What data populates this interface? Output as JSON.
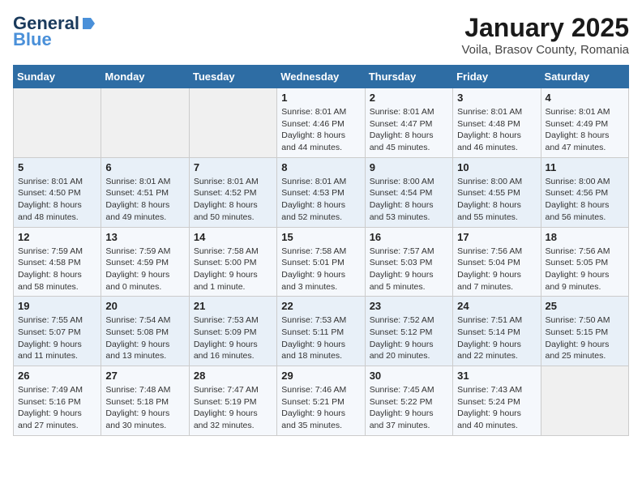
{
  "logo": {
    "brand1": "General",
    "brand2": "Blue",
    "tagline": ""
  },
  "header": {
    "title": "January 2025",
    "subtitle": "Voila, Brasov County, Romania"
  },
  "weekdays": [
    "Sunday",
    "Monday",
    "Tuesday",
    "Wednesday",
    "Thursday",
    "Friday",
    "Saturday"
  ],
  "weeks": [
    [
      {
        "day": "",
        "info": ""
      },
      {
        "day": "",
        "info": ""
      },
      {
        "day": "",
        "info": ""
      },
      {
        "day": "1",
        "info": "Sunrise: 8:01 AM\nSunset: 4:46 PM\nDaylight: 8 hours\nand 44 minutes."
      },
      {
        "day": "2",
        "info": "Sunrise: 8:01 AM\nSunset: 4:47 PM\nDaylight: 8 hours\nand 45 minutes."
      },
      {
        "day": "3",
        "info": "Sunrise: 8:01 AM\nSunset: 4:48 PM\nDaylight: 8 hours\nand 46 minutes."
      },
      {
        "day": "4",
        "info": "Sunrise: 8:01 AM\nSunset: 4:49 PM\nDaylight: 8 hours\nand 47 minutes."
      }
    ],
    [
      {
        "day": "5",
        "info": "Sunrise: 8:01 AM\nSunset: 4:50 PM\nDaylight: 8 hours\nand 48 minutes."
      },
      {
        "day": "6",
        "info": "Sunrise: 8:01 AM\nSunset: 4:51 PM\nDaylight: 8 hours\nand 49 minutes."
      },
      {
        "day": "7",
        "info": "Sunrise: 8:01 AM\nSunset: 4:52 PM\nDaylight: 8 hours\nand 50 minutes."
      },
      {
        "day": "8",
        "info": "Sunrise: 8:01 AM\nSunset: 4:53 PM\nDaylight: 8 hours\nand 52 minutes."
      },
      {
        "day": "9",
        "info": "Sunrise: 8:00 AM\nSunset: 4:54 PM\nDaylight: 8 hours\nand 53 minutes."
      },
      {
        "day": "10",
        "info": "Sunrise: 8:00 AM\nSunset: 4:55 PM\nDaylight: 8 hours\nand 55 minutes."
      },
      {
        "day": "11",
        "info": "Sunrise: 8:00 AM\nSunset: 4:56 PM\nDaylight: 8 hours\nand 56 minutes."
      }
    ],
    [
      {
        "day": "12",
        "info": "Sunrise: 7:59 AM\nSunset: 4:58 PM\nDaylight: 8 hours\nand 58 minutes."
      },
      {
        "day": "13",
        "info": "Sunrise: 7:59 AM\nSunset: 4:59 PM\nDaylight: 9 hours\nand 0 minutes."
      },
      {
        "day": "14",
        "info": "Sunrise: 7:58 AM\nSunset: 5:00 PM\nDaylight: 9 hours\nand 1 minute."
      },
      {
        "day": "15",
        "info": "Sunrise: 7:58 AM\nSunset: 5:01 PM\nDaylight: 9 hours\nand 3 minutes."
      },
      {
        "day": "16",
        "info": "Sunrise: 7:57 AM\nSunset: 5:03 PM\nDaylight: 9 hours\nand 5 minutes."
      },
      {
        "day": "17",
        "info": "Sunrise: 7:56 AM\nSunset: 5:04 PM\nDaylight: 9 hours\nand 7 minutes."
      },
      {
        "day": "18",
        "info": "Sunrise: 7:56 AM\nSunset: 5:05 PM\nDaylight: 9 hours\nand 9 minutes."
      }
    ],
    [
      {
        "day": "19",
        "info": "Sunrise: 7:55 AM\nSunset: 5:07 PM\nDaylight: 9 hours\nand 11 minutes."
      },
      {
        "day": "20",
        "info": "Sunrise: 7:54 AM\nSunset: 5:08 PM\nDaylight: 9 hours\nand 13 minutes."
      },
      {
        "day": "21",
        "info": "Sunrise: 7:53 AM\nSunset: 5:09 PM\nDaylight: 9 hours\nand 16 minutes."
      },
      {
        "day": "22",
        "info": "Sunrise: 7:53 AM\nSunset: 5:11 PM\nDaylight: 9 hours\nand 18 minutes."
      },
      {
        "day": "23",
        "info": "Sunrise: 7:52 AM\nSunset: 5:12 PM\nDaylight: 9 hours\nand 20 minutes."
      },
      {
        "day": "24",
        "info": "Sunrise: 7:51 AM\nSunset: 5:14 PM\nDaylight: 9 hours\nand 22 minutes."
      },
      {
        "day": "25",
        "info": "Sunrise: 7:50 AM\nSunset: 5:15 PM\nDaylight: 9 hours\nand 25 minutes."
      }
    ],
    [
      {
        "day": "26",
        "info": "Sunrise: 7:49 AM\nSunset: 5:16 PM\nDaylight: 9 hours\nand 27 minutes."
      },
      {
        "day": "27",
        "info": "Sunrise: 7:48 AM\nSunset: 5:18 PM\nDaylight: 9 hours\nand 30 minutes."
      },
      {
        "day": "28",
        "info": "Sunrise: 7:47 AM\nSunset: 5:19 PM\nDaylight: 9 hours\nand 32 minutes."
      },
      {
        "day": "29",
        "info": "Sunrise: 7:46 AM\nSunset: 5:21 PM\nDaylight: 9 hours\nand 35 minutes."
      },
      {
        "day": "30",
        "info": "Sunrise: 7:45 AM\nSunset: 5:22 PM\nDaylight: 9 hours\nand 37 minutes."
      },
      {
        "day": "31",
        "info": "Sunrise: 7:43 AM\nSunset: 5:24 PM\nDaylight: 9 hours\nand 40 minutes."
      },
      {
        "day": "",
        "info": ""
      }
    ]
  ]
}
